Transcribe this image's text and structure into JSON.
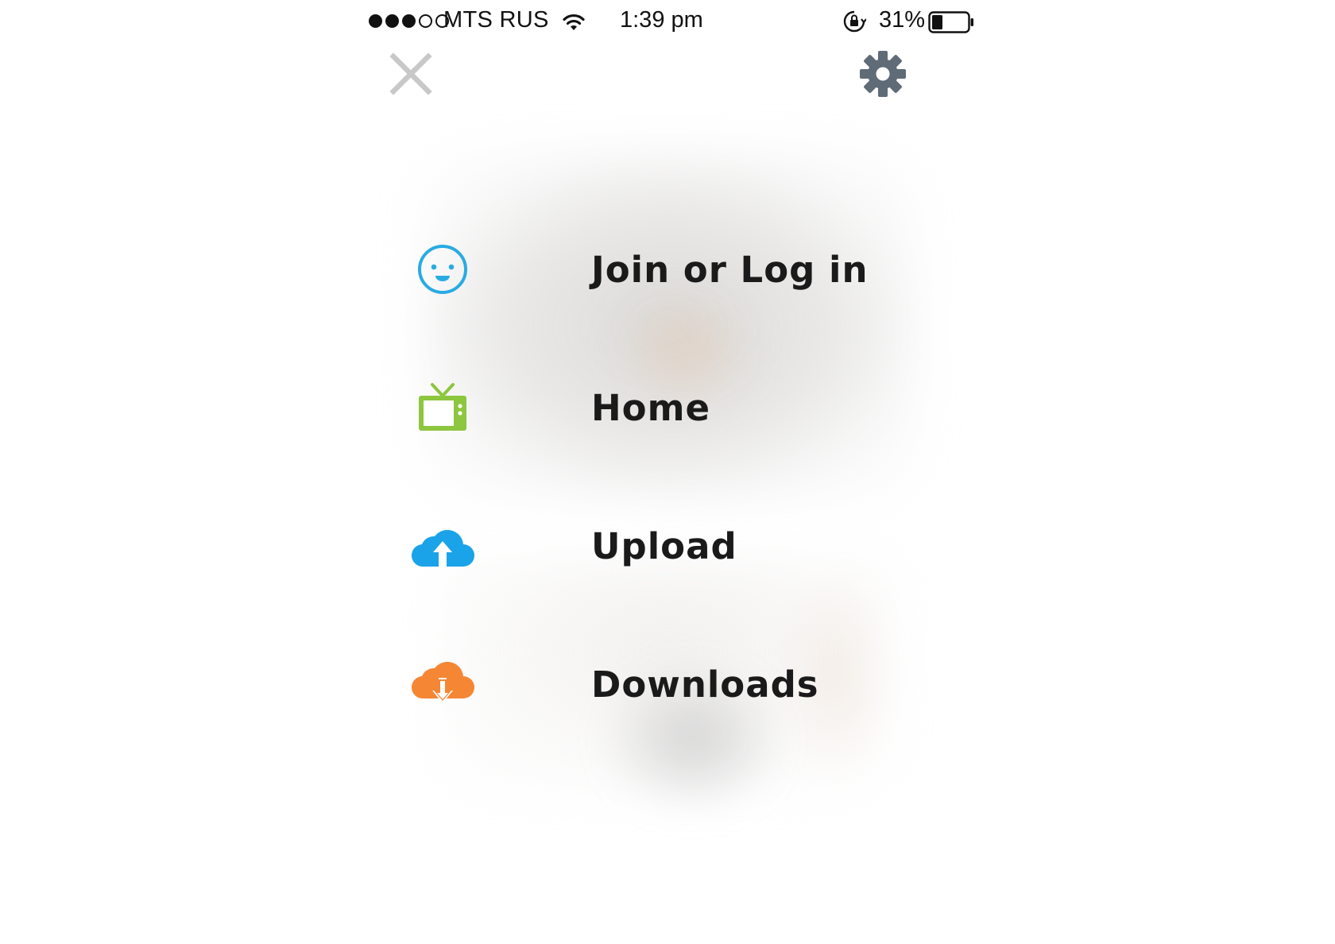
{
  "status_bar": {
    "carrier": "MTS RUS",
    "signal_bars_filled": 3,
    "signal_bars_total": 5,
    "time": "1:39 pm",
    "battery_percent_label": "31%",
    "battery_level": 0.31
  },
  "header": {
    "close_icon": "close-icon",
    "settings_icon": "gear-icon"
  },
  "menu": {
    "items": [
      {
        "label": "Join or Log in",
        "icon": "smiley-face-icon",
        "color": "#29abe2"
      },
      {
        "label": "Home",
        "icon": "tv-icon",
        "color": "#8dc63f"
      },
      {
        "label": "Upload",
        "icon": "cloud-upload-icon",
        "color": "#1aa3e8"
      },
      {
        "label": "Downloads",
        "icon": "cloud-download-icon",
        "color": "#f58634"
      }
    ]
  },
  "colors": {
    "close_icon": "#c8c8c8",
    "settings_icon": "#5f6b77",
    "text": "#1a1a1a"
  }
}
